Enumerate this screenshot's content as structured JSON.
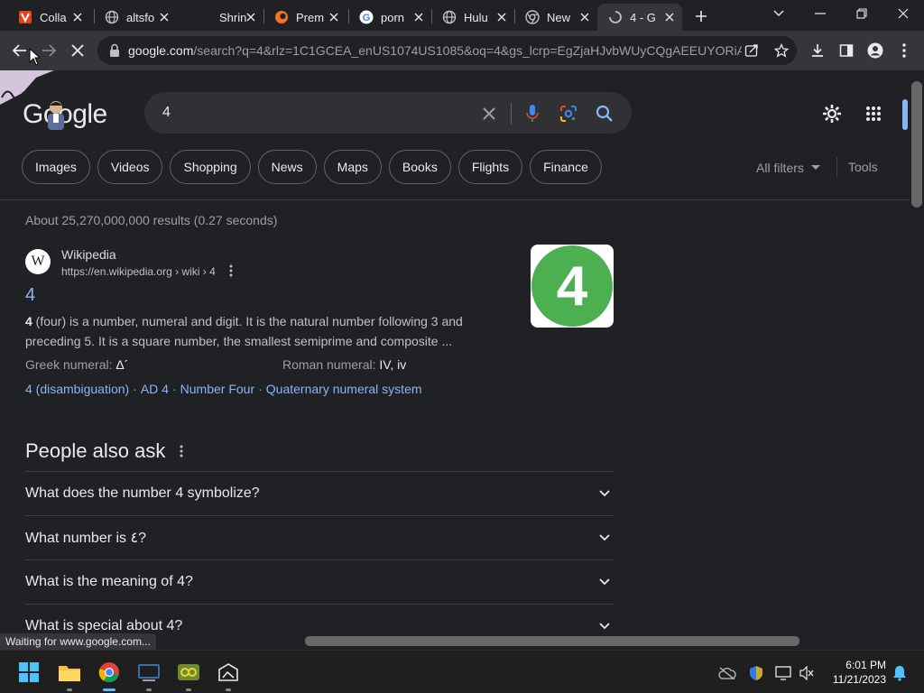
{
  "colors": {
    "page_bg": "#202124",
    "toolbar_bg": "#35363a",
    "link": "#8ab4f8",
    "text": "#e8eaed",
    "muted": "#9aa0a6",
    "thumb_green": "#4caf50"
  },
  "tabs": [
    {
      "title": "Colla",
      "icon": "vivaldi-v-icon",
      "favcolor": "#e5411a"
    },
    {
      "title": "altsfo",
      "icon": "globe-icon",
      "favcolor": "#bdc1c6"
    },
    {
      "title": "Shrin",
      "icon": "none",
      "favcolor": ""
    },
    {
      "title": "Prem",
      "icon": "crunchyroll-icon",
      "favcolor": "#f47521"
    },
    {
      "title": "porn",
      "icon": "google-g-icon",
      "favcolor": "#ffffff"
    },
    {
      "title": "Hulu",
      "icon": "globe-icon",
      "favcolor": "#bdc1c6"
    },
    {
      "title": "New",
      "icon": "chrome-icon",
      "favcolor": "#bdc1c6"
    },
    {
      "title": "4 - G",
      "icon": "loading-icon",
      "favcolor": "#bdc1c6"
    }
  ],
  "toolbar": {
    "url_host": "google.com",
    "url_rest": "/search?q=4&rlz=1C1GCEA_enUS1074US1085&oq=4&gs_lcrp=EgZjaHJvbWUyCQgAEEUYORiA..."
  },
  "search": {
    "query": "4",
    "logo": "Google"
  },
  "chips": [
    "Images",
    "Videos",
    "Shopping",
    "News",
    "Maps",
    "Books",
    "Flights",
    "Finance"
  ],
  "filters": {
    "all_filters": "All filters",
    "tools": "Tools"
  },
  "results_stats": "About 25,270,000,000 results (0.27 seconds)",
  "result": {
    "site_name": "Wikipedia",
    "site_url": "https://en.wikipedia.org › wiki › 4",
    "favicon_letter": "W",
    "title": "4",
    "snippet_bold": "4",
    "snippet_rest": " (four) is a number, numeral and digit. It is the natural number following 3 and preceding 5. It is a square number, the smallest semiprime and composite ...",
    "attr_greek_label": "Greek numeral: ",
    "attr_greek_value": "Δ´",
    "attr_roman_label": "Roman numeral: ",
    "attr_roman_value": "IV, iv",
    "sitelinks": [
      "4 (disambiguation)",
      "AD 4",
      "Number Four",
      "Quaternary numeral system"
    ],
    "thumbnail_text": "4"
  },
  "paa": {
    "title": "People also ask",
    "questions": [
      "What does the number 4 symbolize?",
      "What number is ٤?",
      "What is the meaning of 4?",
      "What is special about 4?"
    ]
  },
  "status_text": "Waiting for www.google.com...",
  "clock": {
    "time": "6:01 PM",
    "date": "11/21/2023"
  }
}
